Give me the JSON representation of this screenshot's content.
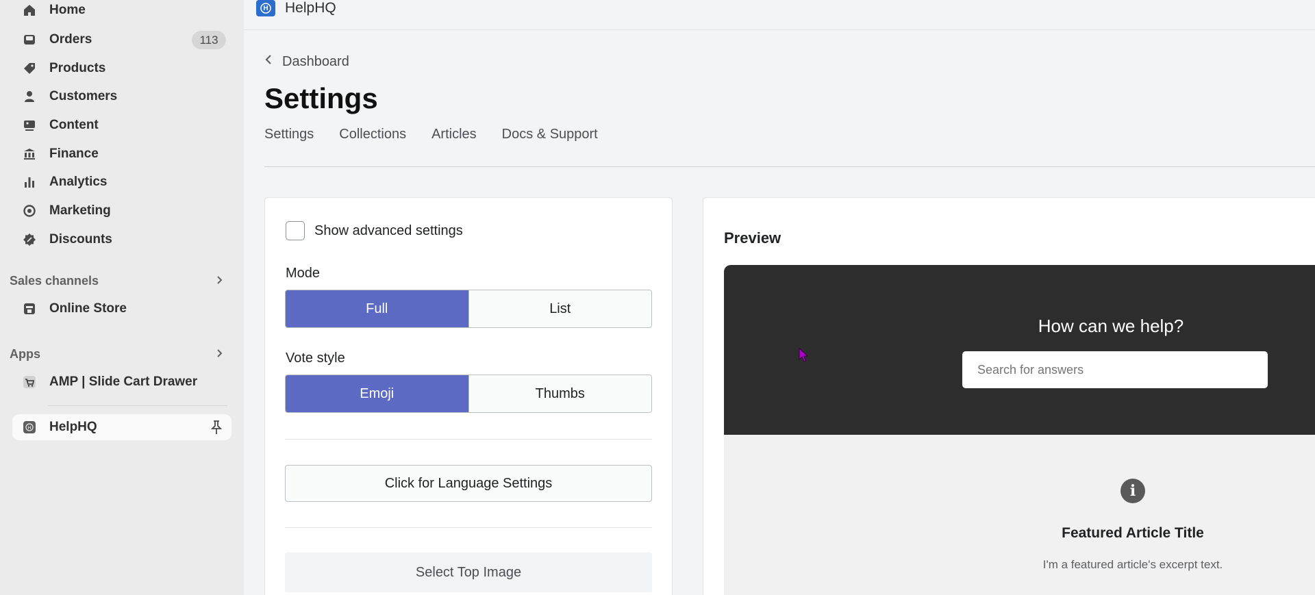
{
  "sidebar": {
    "items": [
      {
        "label": "Home",
        "icon": "home-icon"
      },
      {
        "label": "Orders",
        "icon": "orders-icon",
        "badge": "113"
      },
      {
        "label": "Products",
        "icon": "tag-icon"
      },
      {
        "label": "Customers",
        "icon": "person-icon"
      },
      {
        "label": "Content",
        "icon": "content-icon"
      },
      {
        "label": "Finance",
        "icon": "bank-icon"
      },
      {
        "label": "Analytics",
        "icon": "bar-chart-icon"
      },
      {
        "label": "Marketing",
        "icon": "target-icon"
      },
      {
        "label": "Discounts",
        "icon": "discount-icon"
      }
    ],
    "sales_channels": {
      "title": "Sales channels",
      "items": [
        {
          "label": "Online Store",
          "icon": "store-icon"
        }
      ]
    },
    "apps": {
      "title": "Apps",
      "items": [
        {
          "label": "AMP | Slide Cart Drawer",
          "icon": "cart-app-icon"
        }
      ]
    },
    "pinned": {
      "label": "HelpHQ",
      "icon": "helphq-app-icon"
    }
  },
  "topbar": {
    "app_title": "HelpHQ",
    "logo_letter": "H"
  },
  "breadcrumb": "Dashboard",
  "page_title": "Settings",
  "tabs": [
    "Settings",
    "Collections",
    "Articles",
    "Docs & Support"
  ],
  "settings_card": {
    "advanced_label": "Show advanced settings",
    "advanced_checked": false,
    "mode_label": "Mode",
    "mode_options": [
      "Full",
      "List"
    ],
    "mode_selected": "Full",
    "vote_label": "Vote style",
    "vote_options": [
      "Emoji",
      "Thumbs"
    ],
    "vote_selected": "Emoji",
    "language_button": "Click for Language Settings",
    "top_image_button": "Select Top Image"
  },
  "preview": {
    "title": "Preview",
    "hero_question": "How can we help?",
    "search_placeholder": "Search for answers",
    "featured_title": "Featured Article Title",
    "featured_text": "I'm a featured article's excerpt text."
  },
  "colors": {
    "accent": "#5c6ac4",
    "hero_bg": "#2d2d2d",
    "app_logo": "#2c6ecb"
  }
}
